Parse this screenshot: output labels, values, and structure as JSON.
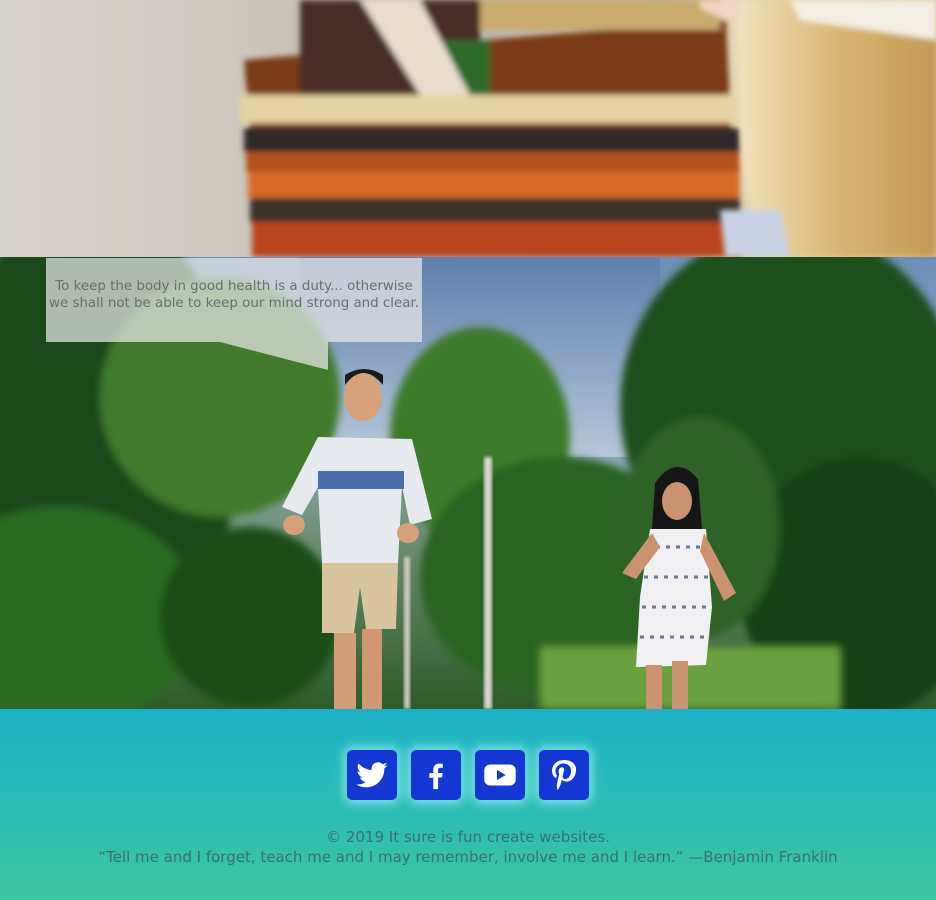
{
  "quote_bubble": {
    "text": "To keep the body in good health is a duty... otherwise we shall not be able to keep our mind strong and clear."
  },
  "social": [
    {
      "name": "twitter",
      "icon": "twitter-icon"
    },
    {
      "name": "facebook",
      "icon": "facebook-icon"
    },
    {
      "name": "youtube",
      "icon": "youtube-icon"
    },
    {
      "name": "pinterest",
      "icon": "pinterest-icon"
    }
  ],
  "footer": {
    "copyright": "© 2019 It sure is fun create websites.",
    "motto": "“Tell me and I forget, teach me and I may remember, involve me and I learn.” —Benjamin Franklin"
  },
  "colors": {
    "footer_top": "#1cb1c6",
    "footer_bottom": "#3cc6a0",
    "social_button": "#1537d3",
    "footer_text": "#3b6f79"
  }
}
